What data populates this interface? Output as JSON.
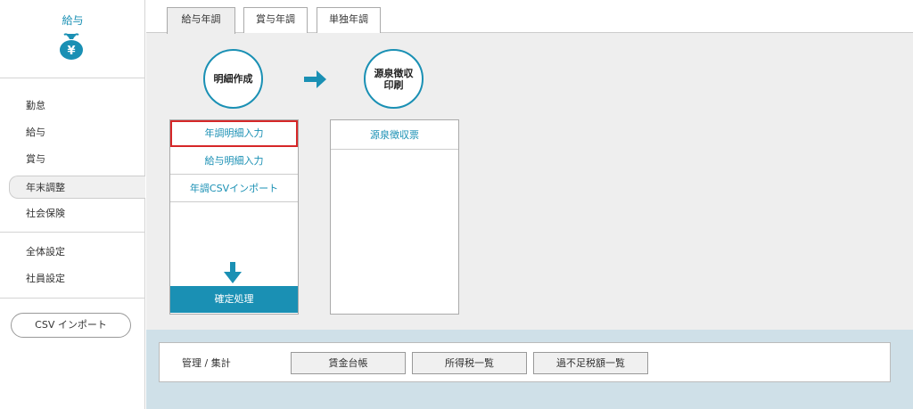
{
  "sidebar": {
    "title": "給与",
    "bag_symbol": "¥",
    "items": [
      {
        "label": "勤怠"
      },
      {
        "label": "給与"
      },
      {
        "label": "賞与"
      },
      {
        "label": "年末調整"
      },
      {
        "label": "社会保険"
      },
      {
        "label": "全体設定"
      },
      {
        "label": "社員設定"
      }
    ],
    "active_index": 3,
    "csv_button": "CSV インポート"
  },
  "tabs": [
    {
      "label": "給与年調"
    },
    {
      "label": "賞与年調"
    },
    {
      "label": "単独年調"
    }
  ],
  "active_tab": 0,
  "steps": {
    "step1": "明細作成",
    "step2_line1": "源泉徴収",
    "step2_line2": "印刷"
  },
  "panel_left": {
    "items": [
      {
        "label": "年調明細入力"
      },
      {
        "label": "給与明細入力"
      },
      {
        "label": "年調CSVインポート"
      }
    ],
    "confirm": "確定処理"
  },
  "panel_right": {
    "items": [
      {
        "label": "源泉徴収票"
      }
    ]
  },
  "management": {
    "label": "管理 / 集計",
    "buttons": [
      {
        "label": "賃金台帳"
      },
      {
        "label": "所得税一覧"
      },
      {
        "label": "過不足税額一覧"
      }
    ]
  },
  "colors": {
    "accent": "#1a90b4",
    "highlight": "#d62728",
    "bottom_bg": "#cfe0e8"
  }
}
